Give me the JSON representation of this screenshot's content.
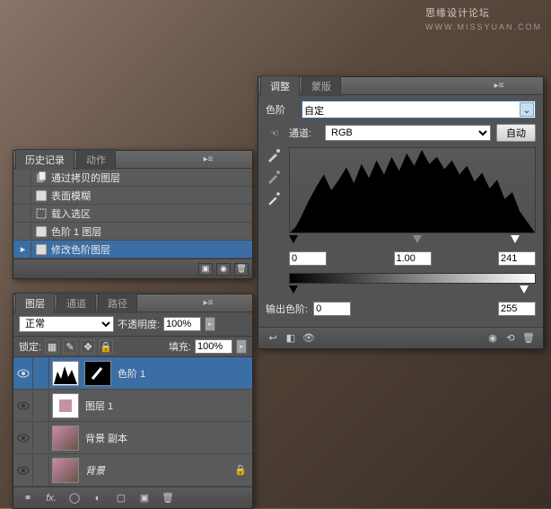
{
  "watermark": {
    "title": "思缘设计论坛",
    "sub": "WWW.MISSYUAN.COM"
  },
  "history": {
    "tabs": [
      "历史记录",
      "动作"
    ],
    "items": [
      {
        "label": "通过拷贝的图层"
      },
      {
        "label": "表面模糊"
      },
      {
        "label": "载入选区"
      },
      {
        "label": "色阶 1 图层"
      },
      {
        "label": "修改色阶图层"
      }
    ]
  },
  "layers": {
    "tabs": [
      "图层",
      "通道",
      "路径"
    ],
    "blend_label": "正常",
    "opacity_label": "不透明度:",
    "opacity_value": "100%",
    "lock_label": "锁定:",
    "fill_label": "填充:",
    "fill_value": "100%",
    "items": [
      {
        "name": "色阶 1",
        "type": "adjust"
      },
      {
        "name": "图层 1",
        "type": "trans"
      },
      {
        "name": "背景 副本",
        "type": "image"
      },
      {
        "name": "背景",
        "type": "bg"
      }
    ]
  },
  "adjust": {
    "tabs": [
      "调整",
      "蒙版"
    ],
    "kind_label": "色阶",
    "preset": "自定",
    "channel_label": "通道:",
    "channel_value": "RGB",
    "auto_label": "自动",
    "input_black": "0",
    "input_gamma": "1.00",
    "input_white": "241",
    "output_label": "输出色阶:",
    "output_black": "0",
    "output_white": "255"
  }
}
